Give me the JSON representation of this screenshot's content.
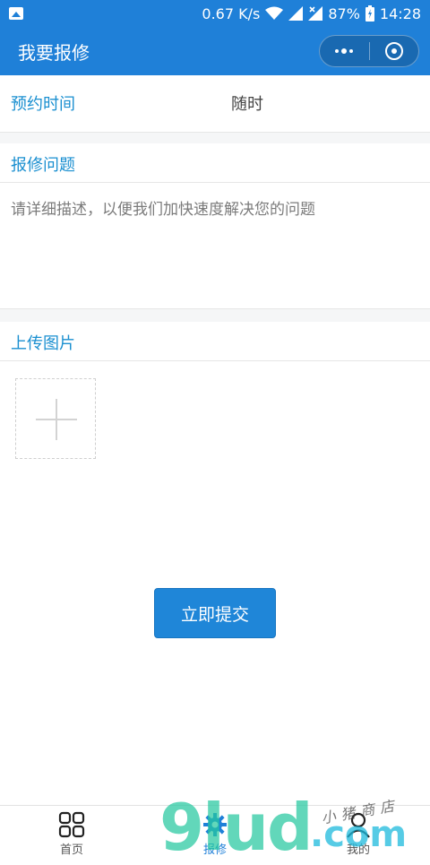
{
  "status_bar": {
    "network_speed": "0.67 K/s",
    "battery": "87%",
    "time": "14:28",
    "icons": [
      "image-notification-icon",
      "wifi-icon",
      "signal-icon",
      "signal-x-icon",
      "battery-charging-icon"
    ]
  },
  "header": {
    "title": "我要报修",
    "capsule": [
      "more-dots-icon",
      "close-target-icon"
    ]
  },
  "form": {
    "appointment": {
      "label": "预约时间",
      "value": "随时"
    },
    "problem": {
      "label": "报修问题",
      "placeholder": "请详细描述，以便我们加快速度解决您的问题"
    },
    "upload": {
      "label": "上传图片",
      "add_icon": "plus-icon"
    },
    "submit_label": "立即提交"
  },
  "tabbar": {
    "items": [
      {
        "label": "首页",
        "icon": "grid-icon",
        "active": false
      },
      {
        "label": "报修",
        "icon": "gear-icon",
        "active": true
      },
      {
        "label": "我的",
        "icon": "user-icon",
        "active": false
      }
    ]
  },
  "watermark": {
    "main": "9lud",
    "suffix": ".com",
    "signature": "小猪商店"
  },
  "colors": {
    "primary": "#1f80d8",
    "label_blue": "#1a8fd0",
    "divider": "#e6e6e6",
    "gap_gray": "#f5f6f7"
  }
}
